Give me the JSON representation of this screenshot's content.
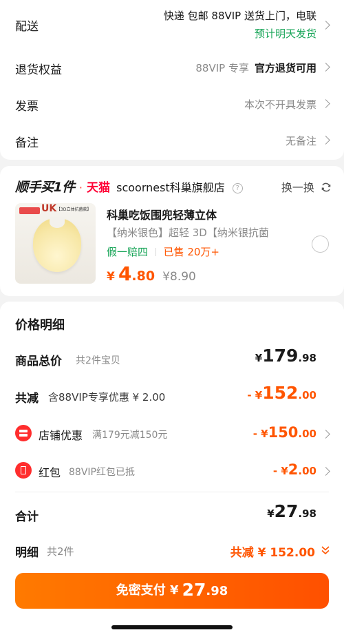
{
  "order_info": {
    "delivery": {
      "label": "配送",
      "value": "快递 包邮 88VIP 送货上门，电联",
      "sub": "预计明天发货"
    },
    "returns": {
      "label": "退货权益",
      "value_gray": "88VIP 专享",
      "value_bold": "官方退货可用"
    },
    "invoice": {
      "label": "发票",
      "value": "本次不开具发票"
    },
    "note": {
      "label": "备注",
      "value": "无备注"
    }
  },
  "recommend": {
    "brand_title": "顺手买1件",
    "dot": "·",
    "tmall": "天猫",
    "store": "scoornest科巢旗舰店",
    "help_icon": "?",
    "refresh_label": "换一换",
    "product": {
      "image_badge": "UK",
      "image_tag": "【3D立体抗菌款】",
      "name": "科巢吃饭围兜轻薄立体",
      "spec": "【纳米银色】超轻 3D【纳米银抗菌",
      "promise": "假一赔四",
      "sales": "已售 20万+",
      "price_symbol": "¥",
      "price_int": "4",
      "price_dec": ".80",
      "original_price": "¥8.90"
    }
  },
  "price_detail": {
    "title": "价格明细",
    "total": {
      "label": "商品总价",
      "sub": "共2件宝贝",
      "symbol": "¥",
      "int": "179",
      "dec": ".98"
    },
    "discount": {
      "label": "共减",
      "sub": "含88VIP专享优惠 ¥ 2.00",
      "prefix": "- ¥",
      "int": "152",
      "dec": ".00"
    },
    "store_coupon": {
      "label": "店铺优惠",
      "sub": "满179元减150元",
      "prefix": "- ¥",
      "int": "150",
      "dec": ".00"
    },
    "red_packet": {
      "label": "红包",
      "sub": "88VIP红包已抵",
      "prefix": "- ¥",
      "int": "2",
      "dec": ".00"
    },
    "subtotal": {
      "label": "合计",
      "symbol": "¥",
      "int": "27",
      "dec": ".98"
    }
  },
  "footer": {
    "detail_label": "明细",
    "detail_sub": "共2件",
    "detail_value": "共减 ¥ 152.00",
    "pay_label": "免密支付 ¥",
    "pay_int": "27",
    "pay_dec": ".98"
  },
  "colors": {
    "accent": "#ff5500",
    "green": "#18a558",
    "pay_gradient_start": "#ff7a00",
    "pay_gradient_end": "#ff5000"
  }
}
